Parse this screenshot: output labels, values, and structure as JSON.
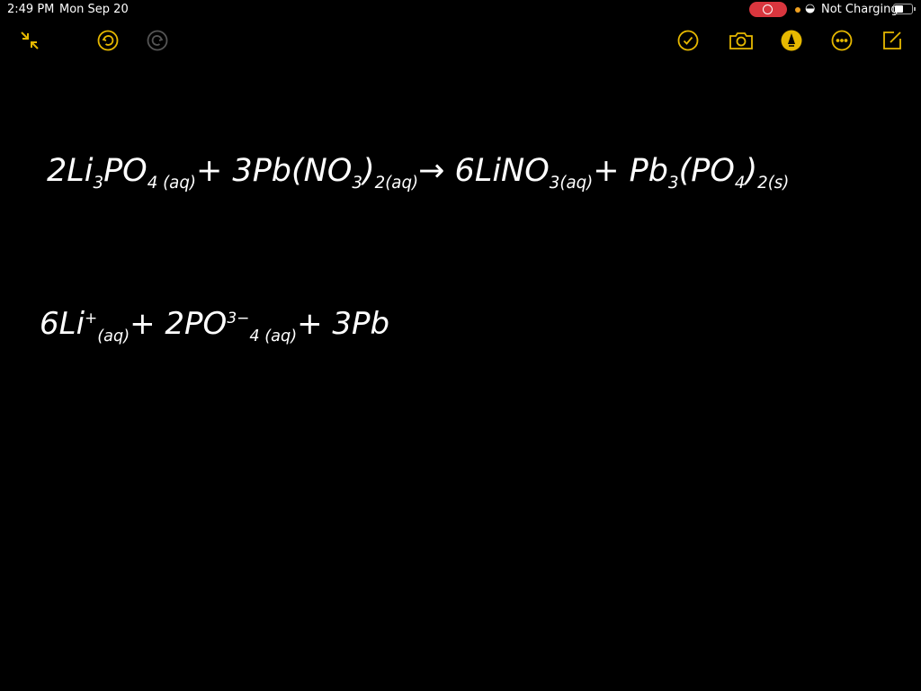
{
  "status_bar": {
    "time": "2:49 PM",
    "date": "Mon Sep 20",
    "charging": "Not Charging",
    "battery_level": 0.45
  },
  "colors": {
    "accent": "#e6b800",
    "record": "#d9363e",
    "background": "#000000",
    "ink": "#ffffff"
  },
  "toolbar": {
    "left": [
      "collapse-icon",
      "undo-icon",
      "redo-icon"
    ],
    "right": [
      "checklist-icon",
      "camera-icon",
      "markup-pen-icon",
      "more-icon",
      "compose-icon"
    ]
  },
  "note": {
    "line1": [
      {
        "b": "2Li",
        "sub": "3"
      },
      {
        "b": "PO",
        "sub": "4 (aq)"
      },
      {
        "b": " + 3Pb(NO",
        "sub": "3"
      },
      {
        "b": ")",
        "sub": "2(aq)"
      },
      {
        "b": "  →  6LiNO",
        "sub": "3(aq)"
      },
      {
        "b": " + Pb",
        "sub": "3"
      },
      {
        "b": "(PO",
        "sub": "4"
      },
      {
        "b": ")",
        "sub": "2(s)"
      }
    ],
    "line2": [
      {
        "b": "6Li",
        "sup": "+",
        "sub": "(aq)"
      },
      {
        "b": " + 2PO",
        "sup": "3−",
        "sub": "4 (aq)"
      },
      {
        "b": " + 3Pb"
      }
    ]
  }
}
